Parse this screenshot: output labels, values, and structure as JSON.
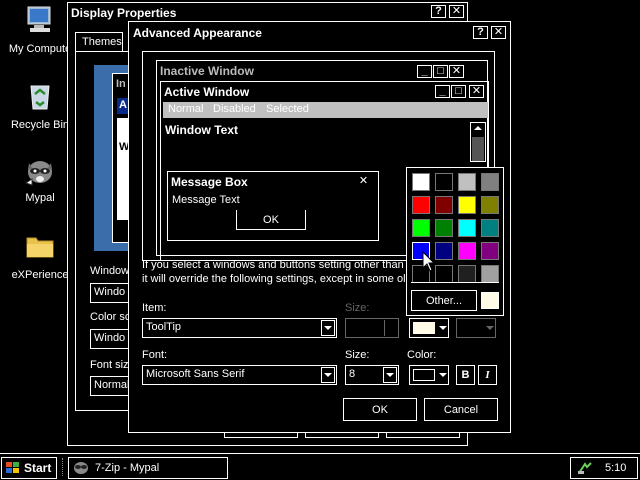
{
  "desktop": {
    "icons": [
      {
        "label": "My Compute"
      },
      {
        "label": "Recycle Bin"
      },
      {
        "label": "Mypal"
      },
      {
        "label": "eXPerience"
      }
    ]
  },
  "display_properties": {
    "title": "Display Properties",
    "help": "?",
    "close": "✕",
    "tab_themes": "Themes",
    "preview_frag": "In",
    "preview_a": "A",
    "preview_w": "W",
    "label_window": "Window",
    "combo_window": "Windo",
    "label_color_scheme": "Color sc",
    "combo_color_scheme": "Windo",
    "label_font_size": "Font size",
    "combo_font_size": "Normal"
  },
  "advanced_appearance": {
    "title": "Advanced Appearance",
    "help": "?",
    "close": "✕",
    "preview": {
      "inactive_title": "Inactive Window",
      "active_title": "Active Window",
      "menu_normal": "Normal",
      "menu_disabled": "Disabled",
      "menu_selected": "Selected",
      "window_text": "Window Text",
      "msgbox_title": "Message Box",
      "msgbox_text": "Message Text",
      "msgbox_ok": "OK"
    },
    "description_line1": "If you select a windows and buttons setting other than",
    "description_line2": "it will override the following settings, except in some ol",
    "item_label": "Item:",
    "item_value": "ToolTip",
    "size_label_top": "Size:",
    "font_label": "Font:",
    "font_value": "Microsoft Sans Serif",
    "size_label": "Size:",
    "size_value": "8",
    "color_label": "Color:",
    "bold_label": "B",
    "italic_label": "I",
    "ok": "OK",
    "cancel": "Cancel"
  },
  "color_picker": {
    "swatches": [
      "#ffffff",
      "#000000",
      "#c0c0c0",
      "#808080",
      "#ff0000",
      "#800000",
      "#ffff00",
      "#808000",
      "#00ff00",
      "#008000",
      "#00ffff",
      "#008080",
      "#0000ff",
      "#000080",
      "#ff00ff",
      "#800080",
      "#000000",
      "#000000",
      "#202020",
      "#a0a0a0"
    ],
    "other": "Other...",
    "current_color": "#fffbe6"
  },
  "taskbar": {
    "start": "Start",
    "task": "7-Zip - Mypal",
    "clock": "5:10"
  }
}
